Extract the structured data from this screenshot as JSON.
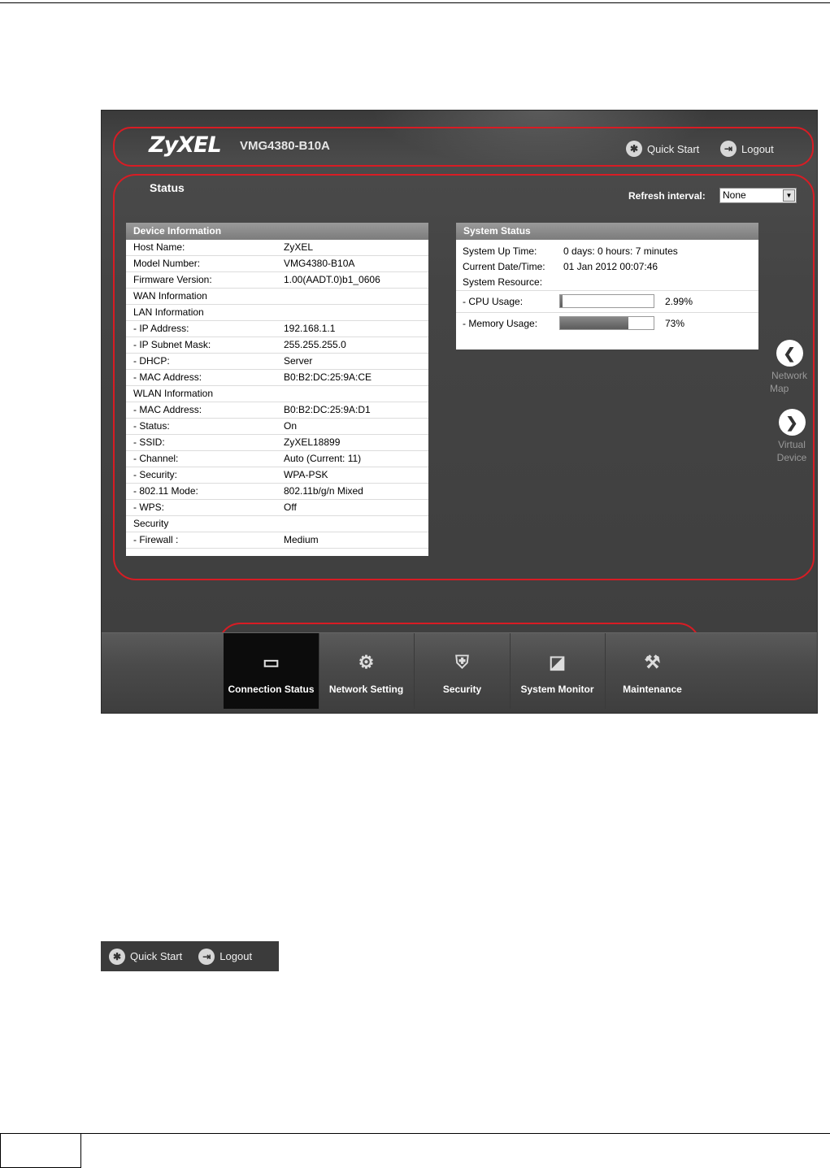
{
  "header": {
    "logo": "ZyXEL",
    "model": "VMG4380-B10A",
    "quick_start": "Quick Start",
    "logout": "Logout"
  },
  "status": {
    "title": "Status",
    "refresh_label": "Refresh interval:",
    "refresh_value": "None"
  },
  "device_info": {
    "title": "Device Information",
    "rows": [
      {
        "k": "Host Name:",
        "v": "ZyXEL"
      },
      {
        "k": "Model Number:",
        "v": "VMG4380-B10A"
      },
      {
        "k": "Firmware Version:",
        "v": "1.00(AADT.0)b1_0606"
      },
      {
        "k": "WAN Information",
        "v": ""
      },
      {
        "k": "LAN Information",
        "v": ""
      },
      {
        "k": " - IP Address:",
        "v": "192.168.1.1"
      },
      {
        "k": " - IP Subnet Mask:",
        "v": "255.255.255.0"
      },
      {
        "k": " - DHCP:",
        "v": "Server"
      },
      {
        "k": " - MAC Address:",
        "v": "B0:B2:DC:25:9A:CE"
      },
      {
        "k": "WLAN Information",
        "v": ""
      },
      {
        "k": " - MAC Address:",
        "v": "B0:B2:DC:25:9A:D1"
      },
      {
        "k": " - Status:",
        "v": "On"
      },
      {
        "k": " - SSID:",
        "v": "ZyXEL18899"
      },
      {
        "k": " - Channel:",
        "v": "Auto (Current: 11)"
      },
      {
        "k": " - Security:",
        "v": "WPA-PSK"
      },
      {
        "k": " - 802.11 Mode:",
        "v": "802.11b/g/n Mixed"
      },
      {
        "k": " - WPS:",
        "v": "Off"
      },
      {
        "k": "Security",
        "v": ""
      },
      {
        "k": " - Firewall :",
        "v": "Medium"
      }
    ]
  },
  "system_status": {
    "title": "System Status",
    "rows": [
      {
        "k": "System Up Time:",
        "v": "0 days: 0 hours: 7 minutes"
      },
      {
        "k": "Current Date/Time:",
        "v": "01 Jan 2012 00:07:46"
      },
      {
        "k": "System Resource:",
        "v": ""
      }
    ],
    "cpu": {
      "label": " - CPU Usage:",
      "text": "2.99%",
      "fraction": 0.0299
    },
    "memory": {
      "label": " - Memory Usage:",
      "text": "73%",
      "fraction": 0.73
    }
  },
  "side_nav": {
    "network_map_line1": "Network",
    "network_map_line2": "Map",
    "virtual_device_line1": "Virtual",
    "virtual_device_line2": "Device"
  },
  "tabs": [
    {
      "label": "Connection Status",
      "icon": "monitor-icon",
      "active": true
    },
    {
      "label": "Network Setting",
      "icon": "gear-icon",
      "active": false
    },
    {
      "label": "Security",
      "icon": "shield-icon",
      "active": false
    },
    {
      "label": "System Monitor",
      "icon": "chart-monitor-icon",
      "active": false
    },
    {
      "label": "Maintenance",
      "icon": "tools-icon",
      "active": false
    }
  ],
  "colors": {
    "highlight": "#d81c24",
    "active_tab": "#0c0c0c"
  }
}
